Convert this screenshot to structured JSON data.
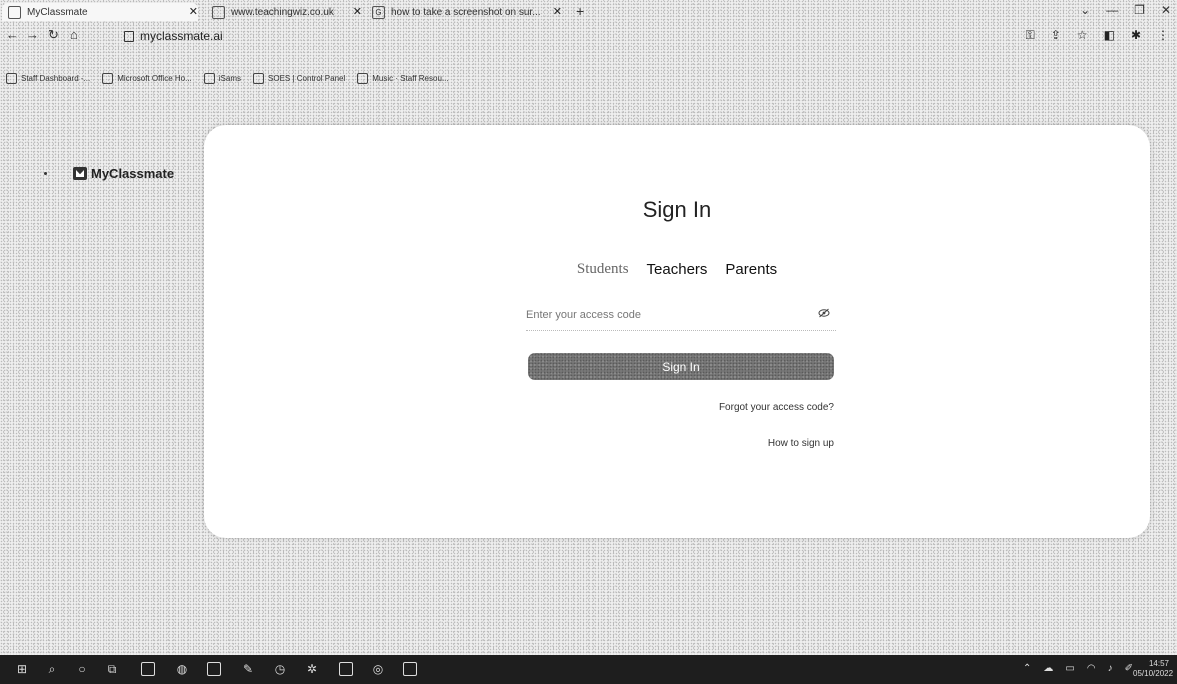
{
  "browser": {
    "tabs": [
      {
        "title": "MyClassmate",
        "active": true
      },
      {
        "title": "www.teachingwiz.co.uk",
        "active": false
      },
      {
        "title": "how to take a screenshot on sur...",
        "active": false
      }
    ],
    "new_tab": "+",
    "url": "myclassmate.ai",
    "bookmarks": [
      "Staff Dashboard -...",
      "Microsoft Office Ho...",
      "iSams",
      "SOES | Control Panel",
      "Music · Staff Resou..."
    ]
  },
  "sidebar": {
    "brand": "MyClassmate"
  },
  "signin": {
    "title": "Sign In",
    "roles": [
      {
        "label": "Students",
        "active": true
      },
      {
        "label": "Teachers",
        "active": false
      },
      {
        "label": "Parents",
        "active": false
      }
    ],
    "access_code_placeholder": "Enter your access code",
    "submit_label": "Sign In",
    "forgot_link": "Forgot your access code?",
    "signup_link": "How to sign up"
  },
  "taskbar": {
    "time": "14:57",
    "date": "05/10/2022"
  }
}
